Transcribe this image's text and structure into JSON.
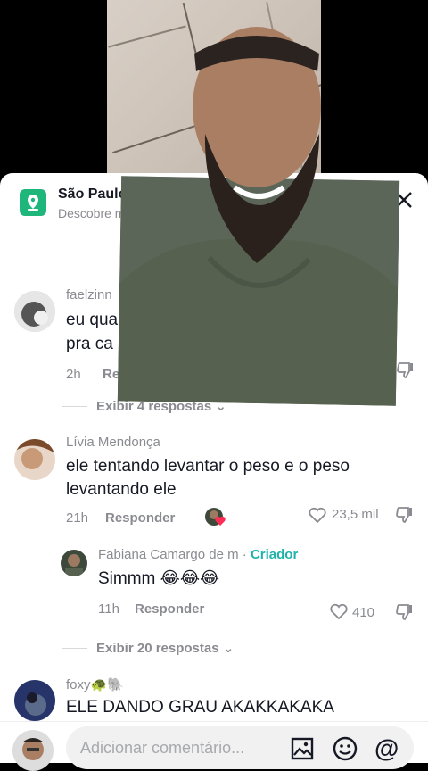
{
  "location": {
    "title": "São Paulo",
    "subtitle": "Descobre mais"
  },
  "comments": [
    {
      "user": "faelzinn",
      "text_line1": "eu qua",
      "text_line2": "pra ca",
      "time": "2h",
      "reply_label": "Re"
    },
    {
      "user": "Lívia Mendonça",
      "text": "ele tentando levantar o peso e o peso levantando ele",
      "time": "21h",
      "reply_label": "Responder",
      "likes": "23,5 mil"
    },
    {
      "user": "Fabiana Camargo de m",
      "creator_sep": "·",
      "creator_label": "Criador",
      "text": "Simmm 😂😂😂",
      "time": "11h",
      "reply_label": "Responder",
      "likes": "410"
    },
    {
      "user": "foxy🐢🐘",
      "text": "ELE DANDO GRAU AKAKKAKAKA"
    }
  ],
  "expanders": [
    "Exibir 4 respostas",
    "Exibir 20 respostas"
  ],
  "input": {
    "placeholder": "Adicionar comentário..."
  },
  "icons": [
    "location-pin-icon",
    "sort-icon",
    "close-icon",
    "heart-icon",
    "dislike-icon",
    "chevron-down-icon",
    "image-icon",
    "emoji-icon",
    "mention-icon"
  ],
  "colors": {
    "accent": "#1fb67c",
    "creator": "#20b2aa",
    "text": "#161823",
    "muted": "#8a8b91",
    "heart": "#fe2c55"
  }
}
